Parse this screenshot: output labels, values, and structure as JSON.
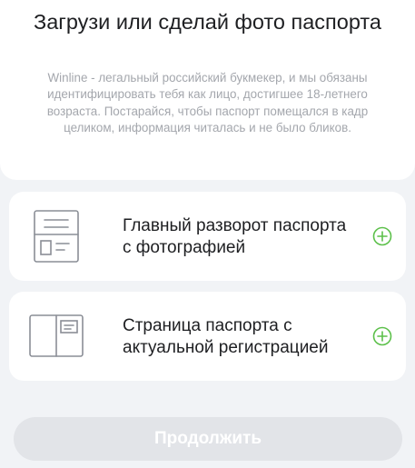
{
  "header": {
    "title": "Загрузи или сделай фото паспорта",
    "subtitle": "Winline - легальный российский букмекер, и мы обязаны идентифицировать тебя как лицо, достигшее 18-летнего возраста. Постарайся, чтобы паспорт помещался в кадр целиком, информация читалась и не было бликов."
  },
  "documents": [
    {
      "label": "Главный разворот паспорта с фотографией",
      "icon": "passport-main-spread-icon",
      "action_icon": "plus-circle-icon"
    },
    {
      "label": "Страница паспорта с актуальной регистрацией",
      "icon": "passport-registration-page-icon",
      "action_icon": "plus-circle-icon"
    }
  ],
  "actions": {
    "continue_label": "Продолжить"
  },
  "colors": {
    "accent": "#5cc04a",
    "background": "#f1f3f6",
    "card": "#ffffff",
    "icon_stroke": "#8a8e96",
    "button_disabled": "#e2e4e8"
  }
}
